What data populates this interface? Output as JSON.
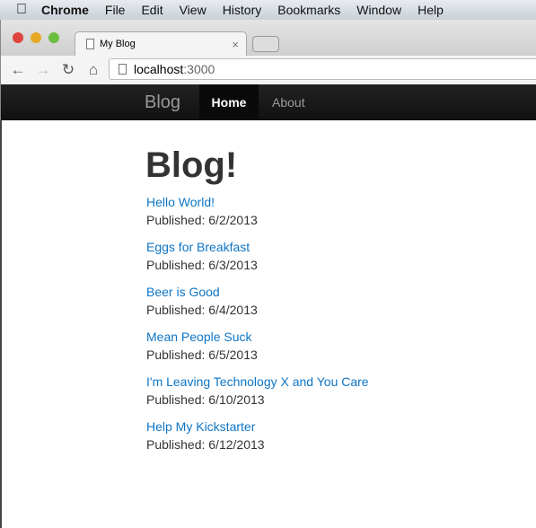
{
  "menubar": {
    "app": "Chrome",
    "items": [
      "File",
      "Edit",
      "View",
      "History",
      "Bookmarks",
      "Window",
      "Help"
    ]
  },
  "browser": {
    "tab_title": "My Blog",
    "url_host": "localhost",
    "url_port": ":3000"
  },
  "navbar": {
    "brand": "Blog",
    "items": [
      {
        "label": "Home",
        "active": true
      },
      {
        "label": "About",
        "active": false
      }
    ]
  },
  "page": {
    "title": "Blog!",
    "posts": [
      {
        "title": "Hello World!",
        "published": "Published: 6/2/2013"
      },
      {
        "title": "Eggs for Breakfast",
        "published": "Published: 6/3/2013"
      },
      {
        "title": "Beer is Good",
        "published": "Published: 6/4/2013"
      },
      {
        "title": "Mean People Suck",
        "published": "Published: 6/5/2013"
      },
      {
        "title": "I'm Leaving Technology X and You Care",
        "published": "Published: 6/10/2013"
      },
      {
        "title": "Help My Kickstarter",
        "published": "Published: 6/12/2013"
      }
    ]
  },
  "colors": {
    "link": "#0e75c5",
    "navbar": "#1a1a1a"
  }
}
